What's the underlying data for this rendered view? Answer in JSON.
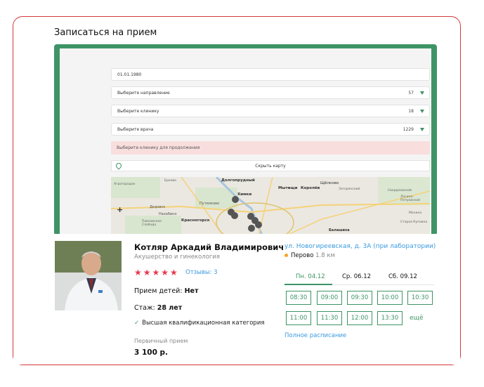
{
  "page_title": "Записаться на прием",
  "form": {
    "birthdate_value": "01.01.1980",
    "fields": [
      {
        "label": "Выберите направление",
        "count": "57"
      },
      {
        "label": "Выберите клинику",
        "count": "18"
      },
      {
        "label": "Выберите врача",
        "count": "1229"
      }
    ],
    "warning": "Выберите клинику для продолжения",
    "toggle_map": "Скрыть карту"
  },
  "map": {
    "labels": [
      "Долгопрудный",
      "Щёлково",
      "Мытищи",
      "Королёв",
      "Химки",
      "Путилково",
      "Дедовск",
      "Нахабино",
      "Красногорск",
      "Балашиха",
      "Агрогородок",
      "Бреево",
      "Загорянский",
      "Свердловский",
      "Лосино-Петровский",
      "Монино",
      "Старая Купавна",
      "Павловская Слобода"
    ],
    "zoom_in": "+"
  },
  "doctor": {
    "name": "Котляр Аркадий Владимирович",
    "specialty": "Акушерство и гинекология",
    "stars": "★★★★★",
    "reviews": "Отзывы: 3",
    "kids_label": "Прием детей:",
    "kids_value": "Нет",
    "experience_label": "Стаж:",
    "experience_value": "28 лет",
    "category": "Высшая квалификационная категория",
    "appointment_type": "Первичный прием",
    "price": "3 100 р."
  },
  "clinic": {
    "address": "ул. Новогиреевская, д. 3А (при лаборатории)",
    "metro": "Перово",
    "distance": "1.8 км"
  },
  "schedule": {
    "days": [
      "Пн. 04.12",
      "Ср. 06.12",
      "Сб. 09.12"
    ],
    "slots": [
      "08:30",
      "09:00",
      "09:30",
      "10:00",
      "10:30",
      "11:00",
      "11:30",
      "12:00",
      "13:30"
    ],
    "more": "ещё",
    "full_schedule": "Полное расписание"
  },
  "colors": {
    "accent": "#3e9466",
    "frame": "#d23a3a",
    "link": "#3a9adf",
    "stars": "#e8384f",
    "warning_bg": "#f9dede"
  }
}
